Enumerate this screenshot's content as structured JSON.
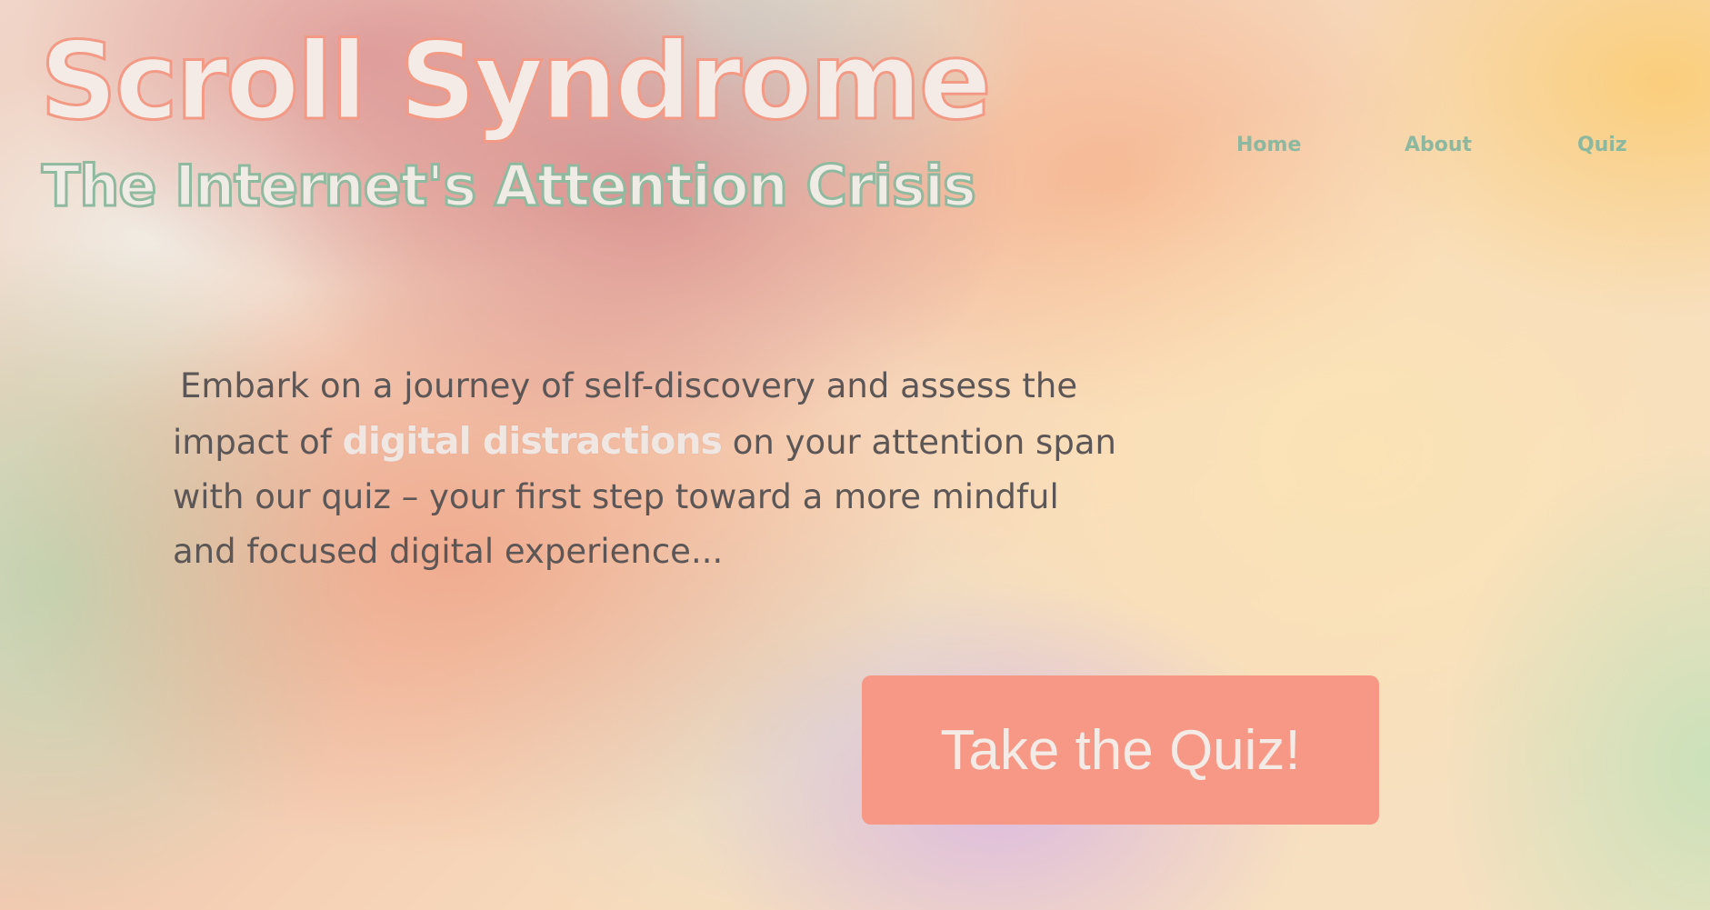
{
  "header": {
    "title": "Scroll Syndrome",
    "subtitle": "The Internet's Attention Crisis"
  },
  "nav": {
    "items": [
      {
        "label": "Home"
      },
      {
        "label": "About"
      },
      {
        "label": "Quiz"
      }
    ]
  },
  "intro": {
    "text_before": "Embark on a journey of self-discovery and assess the impact of",
    "highlight": "digital distractions",
    "text_after": "on your attention span with our quiz – your first step toward a more mindful and focused digital experience..."
  },
  "cta": {
    "label": "Take the Quiz!"
  },
  "colors": {
    "title_fill": "#f4ebe6",
    "title_stroke": "#f29a86",
    "subtitle_stroke": "#8fbaa0",
    "nav_text": "#8cb8a0",
    "body_text": "#5c5756",
    "button_bg": "#f79886",
    "button_text": "#f5ebe6"
  }
}
